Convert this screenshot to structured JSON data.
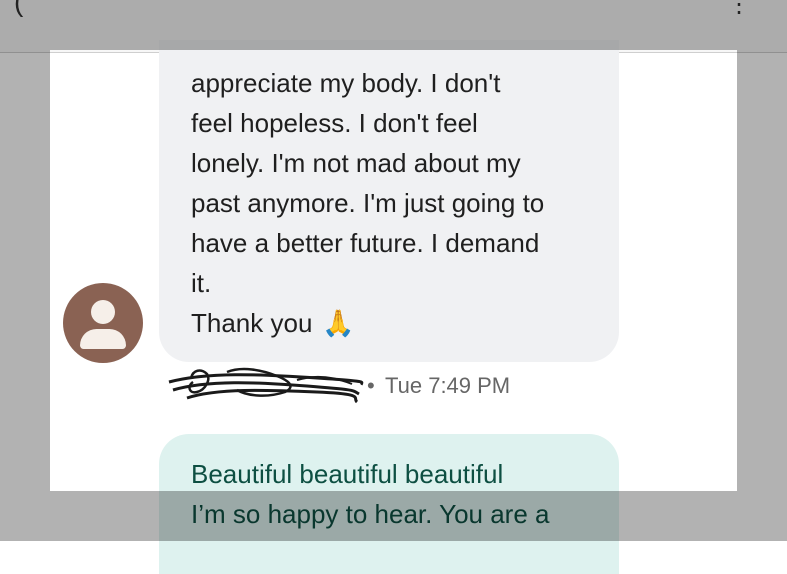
{
  "topbar": {
    "back_glyph": "(",
    "menu_glyph": "⋮"
  },
  "incoming_message": {
    "lines": [
      "appreciate my body. I don't",
      "feel hopeless. I don't feel",
      "lonely. I'm not mad about my",
      "past anymore. I'm just going to",
      "have a better future. I demand",
      "it."
    ],
    "thanks": "Thank you",
    "emoji": "🙏",
    "sender_avatar_icon": "person-icon",
    "sender_avatar_color": "#8a6253",
    "bubble_color": "#f0f1f3"
  },
  "meta": {
    "separator": "•",
    "time": "Tue 7:49 PM"
  },
  "outgoing_message": {
    "lines": [
      "Beautiful beautiful beautiful",
      "I’m so happy to hear. You are a"
    ],
    "bubble_color": "#def2ef",
    "text_color": "#0d4f42"
  }
}
